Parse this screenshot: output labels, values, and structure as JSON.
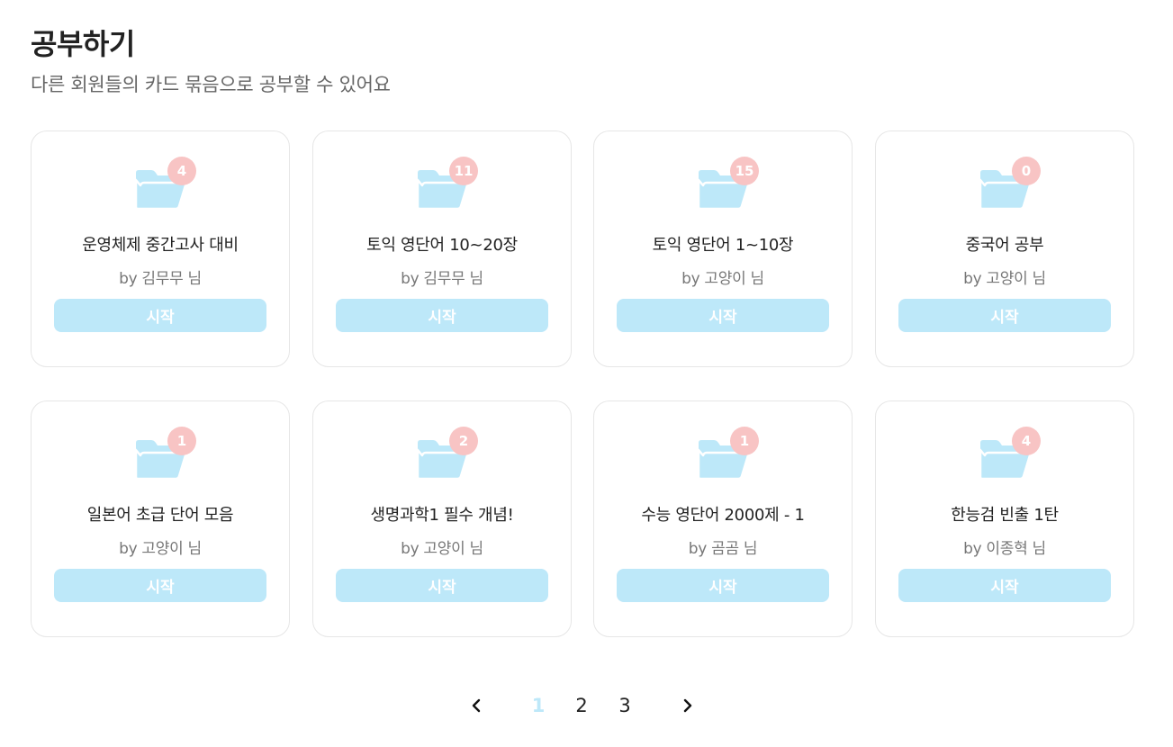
{
  "header": {
    "title": "공부하기",
    "subtitle": "다른 회원들의 카드 묶음으로 공부할 수 있어요"
  },
  "colors": {
    "folder": "#bde8f9",
    "badge": "#f8c4c4",
    "button": "#bde8f9",
    "active_page": "#bde8f9"
  },
  "decks": [
    {
      "count": "4",
      "title": "운영체제 중간고사 대비",
      "author": "by 김무무 님",
      "button_label": "시작"
    },
    {
      "count": "11",
      "title": "토익 영단어 10~20장",
      "author": "by 김무무 님",
      "button_label": "시작"
    },
    {
      "count": "15",
      "title": "토익 영단어 1~10장",
      "author": "by 고양이 님",
      "button_label": "시작"
    },
    {
      "count": "0",
      "title": "중국어 공부",
      "author": "by 고양이 님",
      "button_label": "시작"
    },
    {
      "count": "1",
      "title": "일본어 초급 단어 모음",
      "author": "by 고양이 님",
      "button_label": "시작"
    },
    {
      "count": "2",
      "title": "생명과학1 필수 개념!",
      "author": "by 고양이 님",
      "button_label": "시작"
    },
    {
      "count": "1",
      "title": "수능 영단어 2000제 - 1",
      "author": "by 곰곰 님",
      "button_label": "시작"
    },
    {
      "count": "4",
      "title": "한능검 빈출 1탄",
      "author": "by 이종혁 님",
      "button_label": "시작"
    }
  ],
  "pagination": {
    "prev_icon": "chevron-left-icon",
    "next_icon": "chevron-right-icon",
    "pages": [
      "1",
      "2",
      "3"
    ],
    "current": "1"
  }
}
